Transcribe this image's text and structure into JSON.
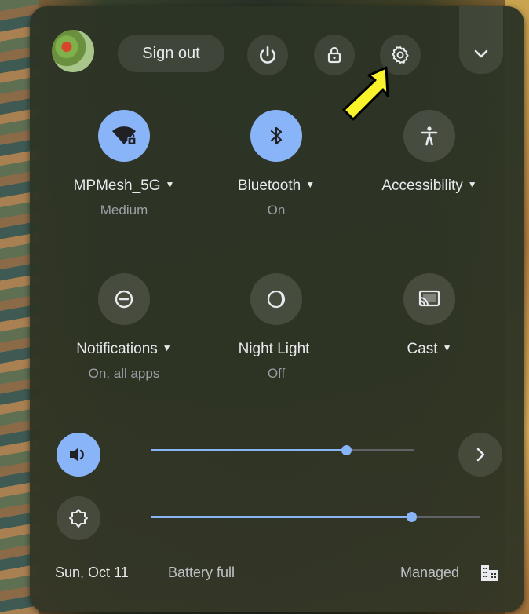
{
  "header": {
    "sign_out_label": "Sign out"
  },
  "tiles": [
    {
      "label": "MPMesh_5G",
      "sub": "Medium",
      "caret": "▼"
    },
    {
      "label": "Bluetooth",
      "sub": "On",
      "caret": "▼"
    },
    {
      "label": "Accessibility",
      "sub": "",
      "caret": "▼"
    },
    {
      "label": "Notifications",
      "sub": "On, all apps",
      "caret": "▼"
    },
    {
      "label": "Night Light",
      "sub": "Off",
      "caret": ""
    },
    {
      "label": "Cast",
      "sub": "",
      "caret": "▼"
    }
  ],
  "sliders": {
    "volume_level": 0.74,
    "brightness_level": 0.79
  },
  "footer": {
    "date": "Sun, Oct 11",
    "battery": "Battery full",
    "managed": "Managed"
  },
  "colors": {
    "accent": "#8ab4f8",
    "pointer_arrow": "#f8f32b"
  },
  "icons": [
    "avatar",
    "power-icon",
    "lock-icon",
    "gear-icon",
    "chevron-down-icon",
    "wifi-locked-icon",
    "bluetooth-icon",
    "accessibility-icon",
    "do-not-disturb-icon",
    "night-light-icon",
    "cast-icon",
    "volume-icon",
    "chevron-right-icon",
    "brightness-icon",
    "building-icon"
  ]
}
